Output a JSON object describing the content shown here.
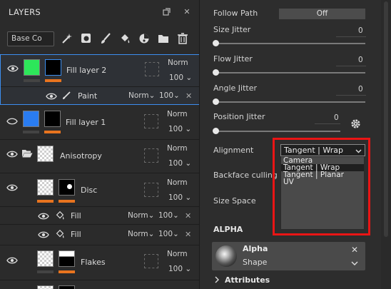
{
  "layers_panel": {
    "title": "LAYERS",
    "blend_mode_select": "Base Co",
    "toolbar_icons": [
      "magic-wand-icon",
      "mask-icon",
      "brush-icon",
      "fill-bucket-icon",
      "effects-icon",
      "folder-icon",
      "trash-icon"
    ],
    "layers": [
      {
        "name": "Fill layer 2",
        "blend": "Norm",
        "opacity": "100",
        "color": "#2de65a",
        "selected": true,
        "sub": {
          "name": "Paint",
          "blend": "Norm",
          "opacity": "100"
        }
      },
      {
        "name": "Fill layer 1",
        "blend": "Norm",
        "opacity": "100",
        "color": "#2a7cf0"
      },
      {
        "name": "Anisotropy",
        "blend": "Norm",
        "opacity": "100"
      },
      {
        "name": "Disc",
        "blend": "Norm",
        "opacity": "100",
        "subs": [
          {
            "name": "Fill",
            "blend": "Norm",
            "opacity": "100"
          },
          {
            "name": "Fill",
            "blend": "Norm",
            "opacity": "100"
          }
        ]
      },
      {
        "name": "Flakes",
        "blend": "Norm",
        "opacity": "100"
      }
    ]
  },
  "properties": {
    "follow_path": {
      "label": "Follow Path",
      "value": "Off"
    },
    "size_jitter": {
      "label": "Size Jitter",
      "value": "0"
    },
    "flow_jitter": {
      "label": "Flow Jitter",
      "value": "0"
    },
    "angle_jitter": {
      "label": "Angle Jitter",
      "value": "0"
    },
    "position_jitter": {
      "label": "Position Jitter",
      "value": "0"
    },
    "alignment": {
      "label": "Alignment",
      "value": "Tangent | Wrap",
      "options": [
        "Camera",
        "Tangent | Wrap",
        "Tangent | Planar",
        "UV"
      ]
    },
    "backface_culling": {
      "label": "Backface culling"
    },
    "size_space": {
      "label": "Size Space"
    },
    "alpha_section": "ALPHA",
    "alpha_resource": {
      "name": "Alpha",
      "type": "Shape"
    },
    "attributes": "Attributes"
  },
  "colors": {
    "selection": "#3c8ef0",
    "highlight_frame": "#ea1515",
    "layer_bar_orange": "#e8741f"
  }
}
